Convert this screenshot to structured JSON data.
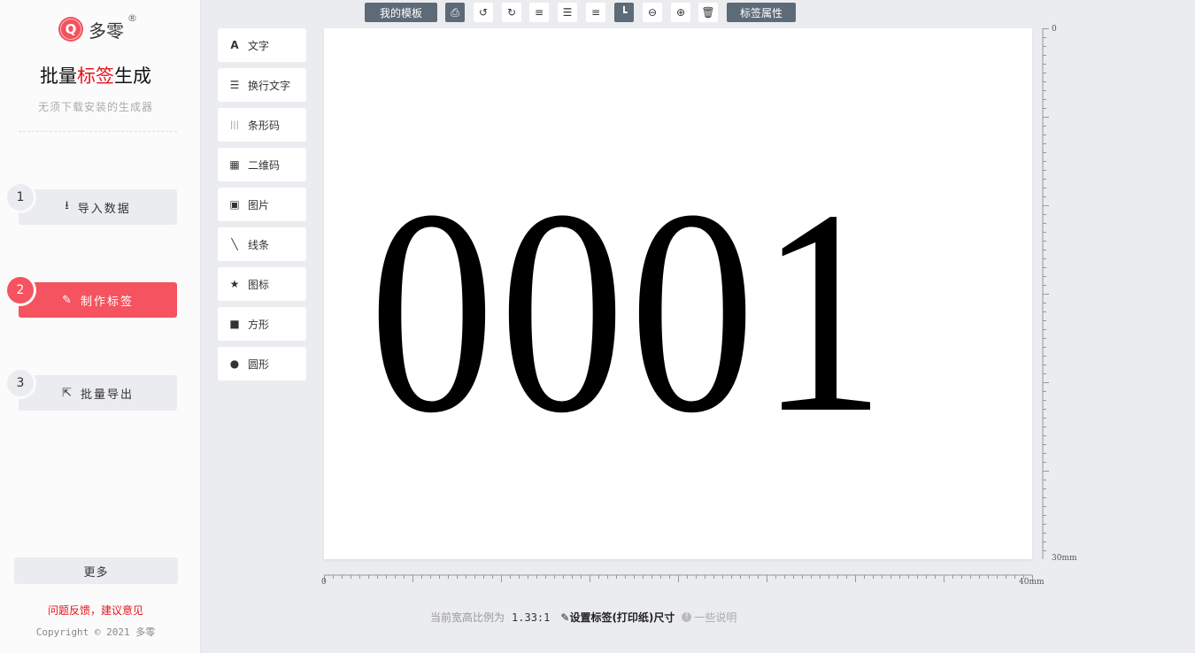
{
  "brand": {
    "mark": "Q",
    "name": "多零",
    "reg": "®"
  },
  "title": {
    "pre": "批量",
    "highlight": "标签",
    "post": "生成"
  },
  "subtitle": "无须下载安装的生成器",
  "steps": [
    {
      "num": "1",
      "label": "导入数据",
      "icon": "download-icon",
      "active": false
    },
    {
      "num": "2",
      "label": "制作标签",
      "icon": "edit-icon",
      "active": true
    },
    {
      "num": "3",
      "label": "批量导出",
      "icon": "share-icon",
      "active": false
    }
  ],
  "more_label": "更多",
  "feedback": "问题反馈，建议意见",
  "copyright": "Copyright © 2021 多零",
  "toolbar": {
    "templates": "我的模板",
    "properties": "标签属性",
    "icons": [
      "print-icon",
      "undo-icon",
      "redo-icon",
      "align-left-icon",
      "align-center-icon",
      "align-right-icon",
      "corner-icon",
      "zoom-out-icon",
      "zoom-in-icon",
      "delete-icon"
    ]
  },
  "tools": [
    {
      "label": "文字",
      "icon": "text-icon",
      "glyph": "A"
    },
    {
      "label": "换行文字",
      "icon": "multiline-text-icon",
      "glyph": "☰"
    },
    {
      "label": "条形码",
      "icon": "barcode-icon",
      "glyph": "|||"
    },
    {
      "label": "二维码",
      "icon": "qrcode-icon",
      "glyph": "▦"
    },
    {
      "label": "图片",
      "icon": "image-icon",
      "glyph": "▣"
    },
    {
      "label": "线条",
      "icon": "line-icon",
      "glyph": "╲"
    },
    {
      "label": "图标",
      "icon": "star-icon",
      "glyph": "★"
    },
    {
      "label": "方形",
      "icon": "square-icon",
      "glyph": "■"
    },
    {
      "label": "圆形",
      "icon": "circle-icon",
      "glyph": "●"
    }
  ],
  "label_content": "0001",
  "ruler": {
    "v_start": "0",
    "v_end": "30mm",
    "h_start": "0",
    "h_end": "40mm"
  },
  "footer": {
    "ratio_label": "当前宽高比例为",
    "ratio_value": "1.33:1",
    "set_size": "设置标签(打印纸)尺寸",
    "note": "一些说明"
  },
  "colors": {
    "accent": "#f4535f",
    "toolbar_dark": "#5d6a77",
    "highlight_red": "#e8141c"
  }
}
